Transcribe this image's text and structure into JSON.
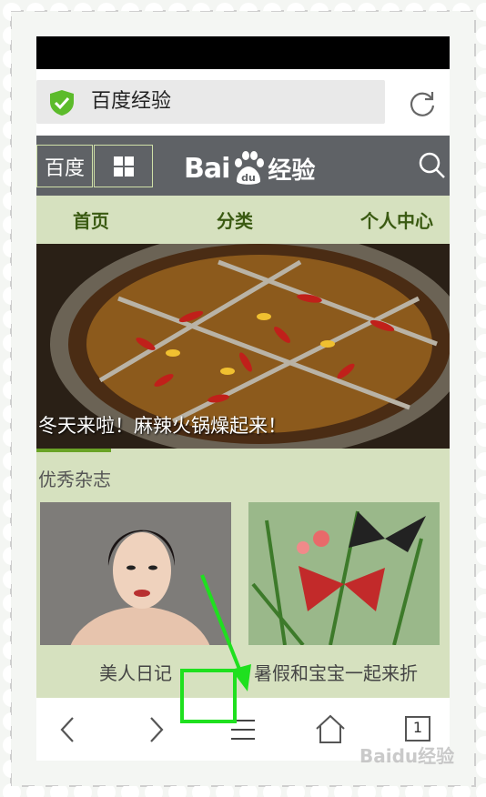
{
  "url_bar": {
    "text": "百度经验"
  },
  "header": {
    "baidu_label": "百度",
    "logo_bai": "Bai",
    "logo_jingyan": "经验"
  },
  "nav": {
    "items": [
      "首页",
      "分类",
      "个人中心"
    ]
  },
  "hero": {
    "caption": "冬天来啦！麻辣火锅燥起来！"
  },
  "magazine": {
    "title": "优秀杂志",
    "cards": [
      {
        "label": "美人日记"
      },
      {
        "label": "暑假和宝宝一起来折"
      }
    ]
  },
  "toolbar": {
    "tabs_count": "1"
  },
  "watermark": {
    "text": "Baidu经验"
  },
  "colors": {
    "accent_green": "#1fe01f",
    "nav_bg": "#d6e1bf",
    "header_bg": "#5f6266"
  }
}
